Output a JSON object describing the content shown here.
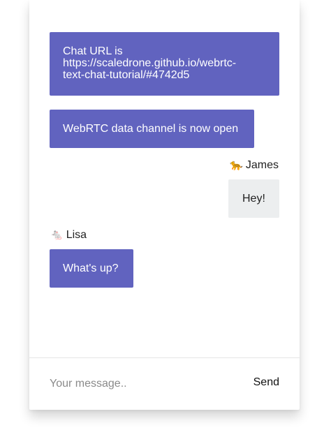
{
  "colors": {
    "bubble_accent": "#6163bf",
    "outgoing_bubble": "#eceeef"
  },
  "messages": [
    {
      "type": "system",
      "text_line1": "Chat URL is",
      "text_line2": "https://scaledrone.github.io/webrtc-",
      "text_line3": "text-chat-tutorial/#4742d5"
    },
    {
      "type": "system",
      "text": "WebRTC data channel is now open"
    },
    {
      "type": "outgoing",
      "sender_emoji": "🐆",
      "sender_name": "James",
      "text": "Hey!"
    },
    {
      "type": "incoming",
      "sender_emoji": "🐁",
      "sender_name": "Lisa",
      "text": "What's up?"
    }
  ],
  "composer": {
    "placeholder": "Your message..",
    "send_label": "Send"
  }
}
